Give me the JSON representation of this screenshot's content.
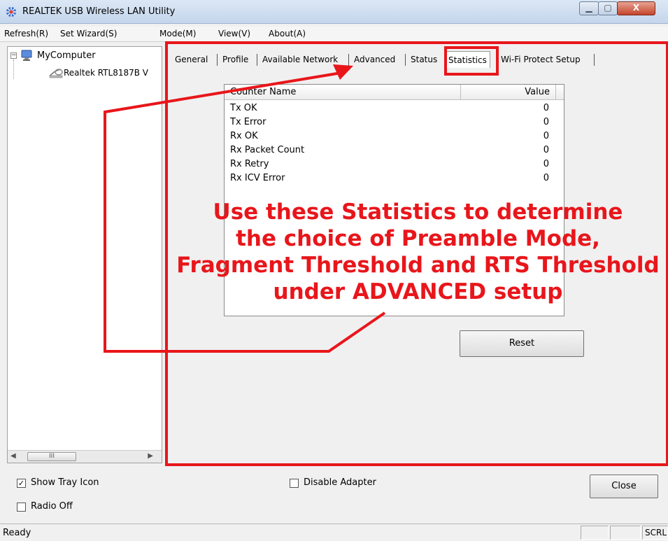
{
  "window": {
    "title": "REALTEK USB Wireless LAN Utility",
    "icon": "network-app-icon",
    "minimize_icon": "minimize-icon",
    "maximize_icon": "maximize-icon",
    "close_label": "X"
  },
  "menu": {
    "items": [
      "Refresh(R)",
      "Set Wizard(S)",
      "Mode(M)",
      "View(V)",
      "About(A)"
    ]
  },
  "tree": {
    "root_label": "MyComputer",
    "adapter_label": "Realtek RTL8187B V",
    "expander": "−",
    "scroll_thumb": "III"
  },
  "tabs": [
    "General",
    "Profile",
    "Available Network",
    "Advanced",
    "Status",
    "Statistics",
    "Wi-Fi Protect Setup"
  ],
  "active_tab": "Statistics",
  "statistics": {
    "headers": {
      "name": "Counter Name",
      "value": "Value"
    },
    "rows": [
      {
        "name": "Tx OK",
        "value": "0"
      },
      {
        "name": "Tx Error",
        "value": "0"
      },
      {
        "name": "Rx OK",
        "value": "0"
      },
      {
        "name": "Rx Packet Count",
        "value": "0"
      },
      {
        "name": "Rx Retry",
        "value": "0"
      },
      {
        "name": "Rx ICV Error",
        "value": "0"
      }
    ],
    "reset_label": "Reset"
  },
  "options": {
    "show_tray_icon": {
      "label": "Show Tray Icon",
      "checked": true
    },
    "radio_off": {
      "label": "Radio Off",
      "checked": false
    },
    "disable_adapter": {
      "label": "Disable Adapter",
      "checked": false
    }
  },
  "close_label": "Close",
  "status": {
    "text": "Ready",
    "pane3": "SCRL"
  },
  "annotation": {
    "lines": [
      "Use these Statistics to determine",
      "the choice of Preamble Mode,",
      "Fragment Threshold and RTS Threshold",
      "under ADVANCED setup"
    ],
    "color": "#e8161b"
  }
}
